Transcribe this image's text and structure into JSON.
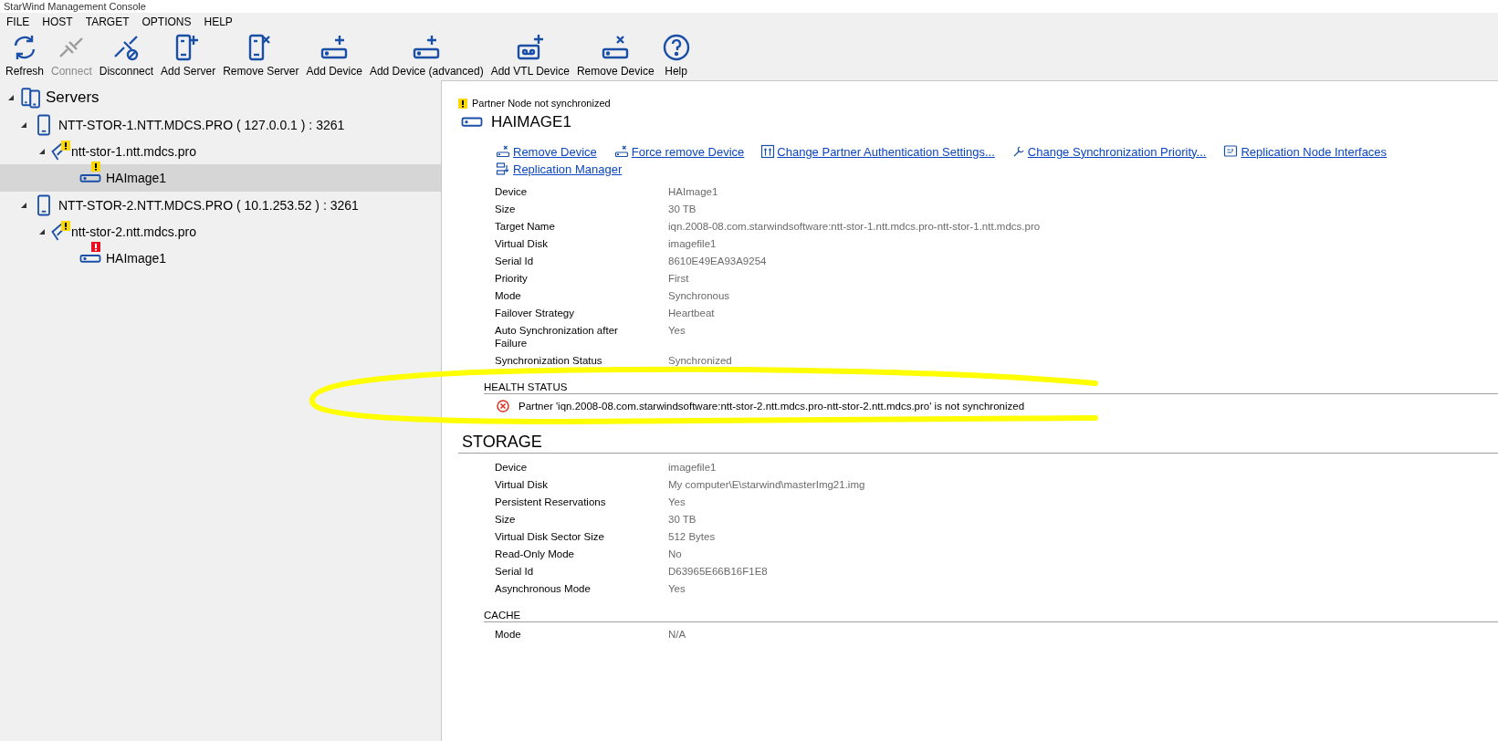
{
  "window": {
    "title": "StarWind Management Console"
  },
  "menu": [
    "FILE",
    "HOST",
    "TARGET",
    "OPTIONS",
    "HELP"
  ],
  "toolbar": [
    {
      "label": "Refresh",
      "disabled": false
    },
    {
      "label": "Connect",
      "disabled": true
    },
    {
      "label": "Disconnect",
      "disabled": false
    },
    {
      "label": "Add Server",
      "disabled": false
    },
    {
      "label": "Remove Server",
      "disabled": false
    },
    {
      "label": "Add Device",
      "disabled": false
    },
    {
      "label": "Add Device (advanced)",
      "disabled": false
    },
    {
      "label": "Add VTL Device",
      "disabled": false
    },
    {
      "label": "Remove Device",
      "disabled": false
    },
    {
      "label": "Help",
      "disabled": false
    }
  ],
  "tree": [
    {
      "label": "Servers",
      "kind": "root",
      "expanded": true,
      "selected": false,
      "children": [
        {
          "label": "NTT-STOR-1.NTT.MDCS.PRO ( 127.0.0.1 ) : 3261",
          "kind": "server",
          "expanded": true,
          "selected": false,
          "children": [
            {
              "label": "ntt-stor-1.ntt.mdcs.pro",
              "kind": "target",
              "warning": true,
              "error": false,
              "expanded": true,
              "selected": false,
              "children": [
                {
                  "label": "HAImage1",
                  "kind": "device",
                  "warning": true,
                  "error": false,
                  "selected": true
                }
              ]
            }
          ]
        },
        {
          "label": "NTT-STOR-2.NTT.MDCS.PRO ( 10.1.253.52 ) : 3261",
          "kind": "server",
          "expanded": true,
          "selected": false,
          "children": [
            {
              "label": "ntt-stor-2.ntt.mdcs.pro",
              "kind": "target",
              "warning": true,
              "error": false,
              "expanded": true,
              "selected": false,
              "children": [
                {
                  "label": "HAImage1",
                  "kind": "device",
                  "warning": false,
                  "error": true,
                  "selected": false
                }
              ]
            }
          ]
        }
      ]
    }
  ],
  "detail": {
    "alert": {
      "warning": true,
      "text": "Partner Node not synchronized"
    },
    "title": "HAIMAGE1",
    "links": [
      "Remove Device",
      "Force remove Device",
      "Change Partner Authentication Settings...",
      "Change Synchronization Priority...",
      "Replication Node Interfaces",
      "Replication Manager"
    ],
    "properties": [
      {
        "label": "Device",
        "value": "HAImage1"
      },
      {
        "label": "Size",
        "value": "30 TB"
      },
      {
        "label": "Target Name",
        "value": "iqn.2008-08.com.starwindsoftware:ntt-stor-1.ntt.mdcs.pro-ntt-stor-1.ntt.mdcs.pro"
      },
      {
        "label": "Virtual Disk",
        "value": "imagefile1"
      },
      {
        "label": "Serial Id",
        "value": "8610E49EA93A9254"
      },
      {
        "label": "Priority",
        "value": "First"
      },
      {
        "label": "Mode",
        "value": "Synchronous"
      },
      {
        "label": "Failover Strategy",
        "value": "Heartbeat"
      },
      {
        "label": "Auto Synchronization after Failure",
        "value": "Yes"
      },
      {
        "label": "Synchronization Status",
        "value": "Synchronized"
      }
    ],
    "sections": [
      {
        "title": "HEALTH STATUS",
        "kind": "minor",
        "messages": [
          {
            "error": true,
            "text": "Partner 'iqn.2008-08.com.starwindsoftware:ntt-stor-2.ntt.mdcs.pro-ntt-stor-2.ntt.mdcs.pro' is not synchronized"
          }
        ]
      },
      {
        "title": "STORAGE",
        "kind": "major",
        "properties": [
          {
            "label": "Device",
            "value": "imagefile1"
          },
          {
            "label": "Virtual Disk",
            "value": "My computer\\E\\starwind\\masterImg21.img"
          },
          {
            "label": "Persistent Reservations",
            "value": "Yes"
          },
          {
            "label": "Size",
            "value": "30 TB"
          },
          {
            "label": "Virtual Disk Sector Size",
            "value": "512 Bytes"
          },
          {
            "label": "Read-Only Mode",
            "value": "No"
          },
          {
            "label": "Serial Id",
            "value": "D63965E66B16F1E8"
          },
          {
            "label": "Asynchronous Mode",
            "value": "Yes"
          }
        ]
      },
      {
        "title": "CACHE",
        "kind": "minor",
        "properties": [
          {
            "label": "Mode",
            "value": "N/A"
          }
        ]
      }
    ]
  }
}
